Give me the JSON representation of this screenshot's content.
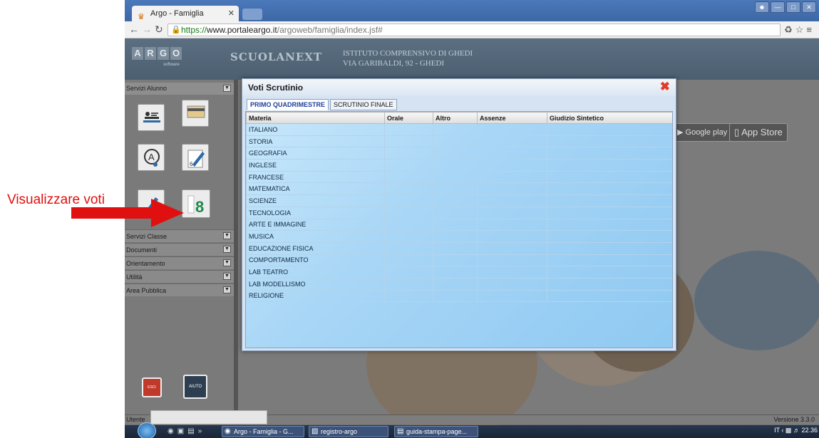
{
  "browser": {
    "tab_title": "Argo - Famiglia",
    "url_secure": "https://",
    "url_host": "www.portaleargo.it",
    "url_path": "/argoweb/famiglia/index.jsf#"
  },
  "app": {
    "logo_letters": [
      "A",
      "R",
      "G",
      "O"
    ],
    "logo_sub": "software",
    "brand": "SCUOLANEXT",
    "school_name": "ISTITUTO COMPRENSIVO DI GHEDI",
    "school_address": "VIA GARIBALDI, 92 - GHEDI",
    "google_play": "Google play",
    "app_store": "App Store"
  },
  "sidebar": {
    "section_title": "Servizi Alunno",
    "menu": [
      "Servizi Classe",
      "Documenti",
      "Orientamento",
      "Utilità",
      "Area Pubblica"
    ],
    "exit_label": "ESCI",
    "help_label": "AIUTO"
  },
  "dialog": {
    "title": "Voti Scrutinio",
    "tabs": [
      "PRIMO QUADRIMESTRE",
      "SCRUTINIO FINALE"
    ],
    "columns": [
      "Materia",
      "Orale",
      "Altro",
      "Assenze",
      "Giudizio Sintetico"
    ],
    "subjects": [
      "ITALIANO",
      "STORIA",
      "GEOGRAFIA",
      "INGLESE",
      "FRANCESE",
      "MATEMATICA",
      "SCIENZE",
      "TECNOLOGIA",
      "ARTE E IMMAGINE",
      "MUSICA",
      "EDUCAZIONE FISICA",
      "COMPORTAMENTO",
      "LAB TEATRO",
      "LAB MODELLISMO",
      "RELIGIONE"
    ]
  },
  "statusbar": {
    "user_label": "Utente",
    "version": "Versione 3.3.0"
  },
  "taskbar": {
    "items": [
      "Argo - Famiglia - G...",
      "registro-argo",
      "guida-stampa-page..."
    ],
    "tray_lang": "IT",
    "time": "22.36"
  },
  "annotation": {
    "text": "Visualizzare voti"
  },
  "colors": {
    "accent": "#1f3f9c",
    "close": "#e03a2a",
    "annotation": "#e01010"
  }
}
